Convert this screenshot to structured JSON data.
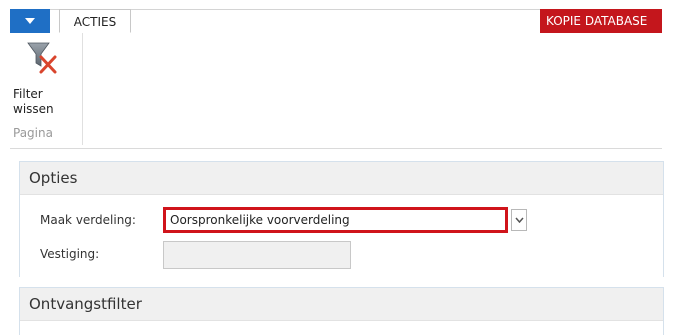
{
  "ribbon": {
    "tabs": [
      {
        "label": "ACTIES"
      }
    ],
    "database_badge": "KOPIE DATABASE",
    "actions": [
      {
        "label_line1": "Filter",
        "label_line2": "wissen",
        "icon": "clear-filter-icon"
      }
    ],
    "group_label": "Pagina"
  },
  "opties": {
    "header": "Opties",
    "maak_verdeling_label": "Maak verdeling:",
    "maak_verdeling_value": "Oorspronkelijke voorverdeling",
    "vestiging_label": "Vestiging:",
    "vestiging_value": ""
  },
  "ontvangstfilter": {
    "header": "Ontvangstfilter"
  },
  "colors": {
    "app_button": "#1f6fc5",
    "badge": "#c4161c",
    "highlight_border": "#d0141b"
  }
}
